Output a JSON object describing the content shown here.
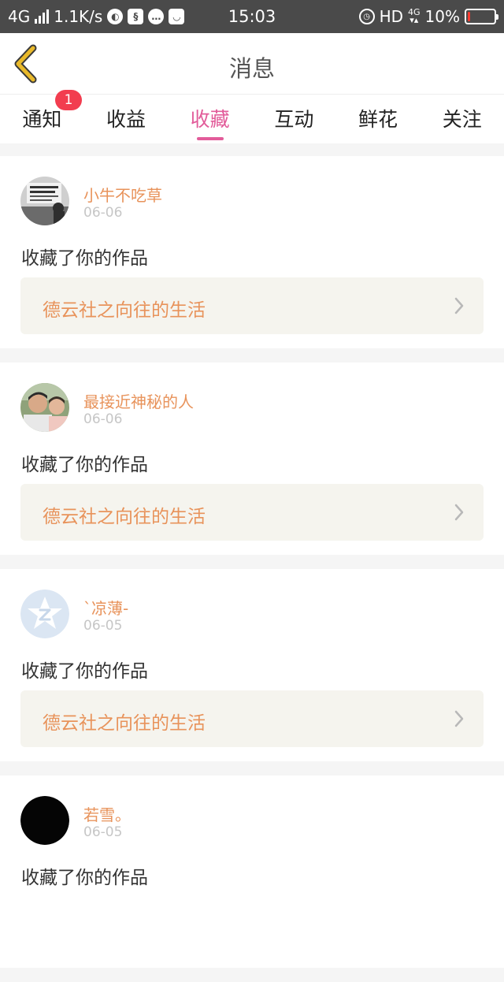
{
  "status_bar": {
    "network": "4G",
    "speed": "1.1K/s",
    "time": "15:03",
    "hd": "HD",
    "net_small": "4G",
    "battery_percent": "10%",
    "battery_level": 0.1,
    "icons": [
      "signal-icon",
      "browser-icon",
      "app-icon",
      "chat-icon",
      "mail-icon",
      "alarm-icon"
    ]
  },
  "nav": {
    "title": "消息",
    "back_icon": "chevron-left-icon"
  },
  "tabs": [
    {
      "label": "通知",
      "badge": "1"
    },
    {
      "label": "收益"
    },
    {
      "label": "收藏",
      "active": true
    },
    {
      "label": "互动"
    },
    {
      "label": "鲜花"
    },
    {
      "label": "关注"
    }
  ],
  "messages": [
    {
      "user": "小牛不吃草",
      "date": "06-06",
      "action": "收藏了你的作品",
      "work": "德云社之向往的生活",
      "avatar": "photo-avatar"
    },
    {
      "user": "最接近神秘的人",
      "date": "06-06",
      "action": "收藏了你的作品",
      "work": "德云社之向往的生活",
      "avatar": "photo-avatar"
    },
    {
      "user": "ˋ凉薄-",
      "date": "06-05",
      "action": "收藏了你的作品",
      "work": "德云社之向往的生活",
      "avatar": "default-avatar"
    },
    {
      "user": "若雪。",
      "date": "06-05",
      "action": "收藏了你的作品",
      "work": "",
      "avatar": "black-avatar"
    }
  ],
  "colors": {
    "accent_pink": "#e25c9a",
    "username_orange": "#e8935b",
    "back_yellow": "#e9b92a",
    "badge_red": "#f23d4f"
  }
}
